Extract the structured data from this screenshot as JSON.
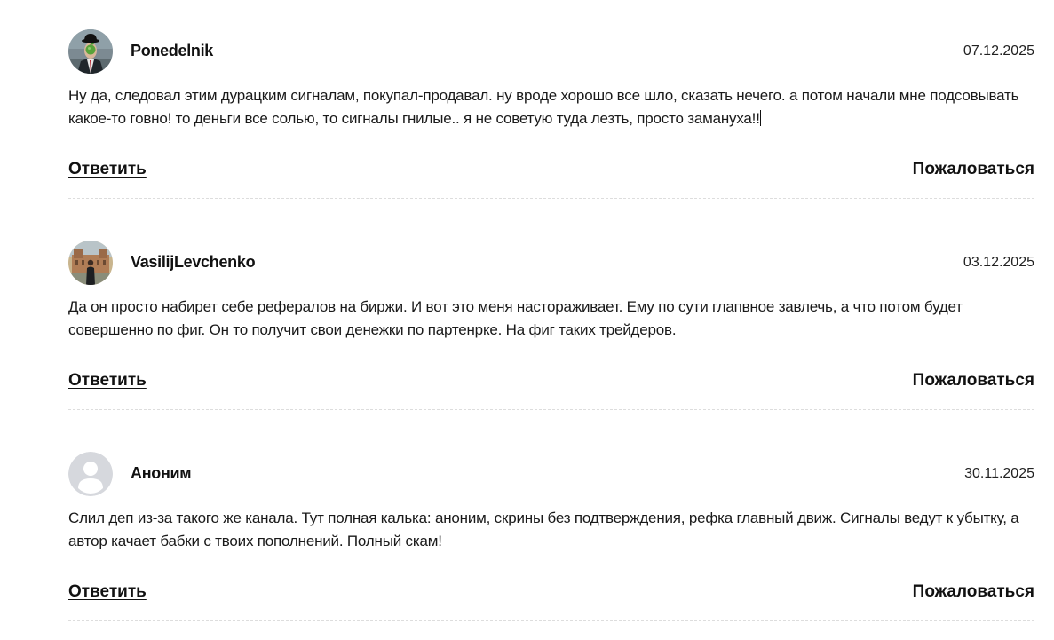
{
  "comments": [
    {
      "author": "Ponedelnik",
      "date": "07.12.2025",
      "avatar": "man-with-apple-avatar",
      "text": "Ну да, следовал этим дурацким сигналам, покупал-продавал. ну вроде хорошо все шло, сказать нечего. а потом начали мне подсовывать какое-то говно! то деньги все солью, то сигналы гнилые.. я не советую туда лезть, просто замануха!!",
      "reply_label": "Ответить",
      "report_label": "Пожаловаться"
    },
    {
      "author": "VasilijLevchenko",
      "date": "03.12.2025",
      "avatar": "man-in-front-of-building-avatar",
      "text": "Да он просто набирет себе рефералов на биржи. И вот это меня настораживает. Ему по сути глапвное завлечь, а что потом будет совершенно по фиг. Он то получит свои денежки по партенрке. На фиг таких трейдеров.",
      "reply_label": "Ответить",
      "report_label": "Пожаловаться"
    },
    {
      "author": "Аноним",
      "date": "30.11.2025",
      "avatar": "default-user-avatar",
      "text": "Слил деп из-за такого же канала. Тут полная калька: аноним, скрины без подтверждения, рефка главный движ. Сигналы ведут к убытку, а автор качает бабки с твоих пополнений. Полный скам!",
      "reply_label": "Ответить",
      "report_label": "Пожаловаться"
    }
  ],
  "colors": {
    "text": "#1a1a1a",
    "divider": "#dddddd",
    "default_avatar_bg": "#d6d8dd",
    "default_avatar_fg": "#ffffff"
  }
}
